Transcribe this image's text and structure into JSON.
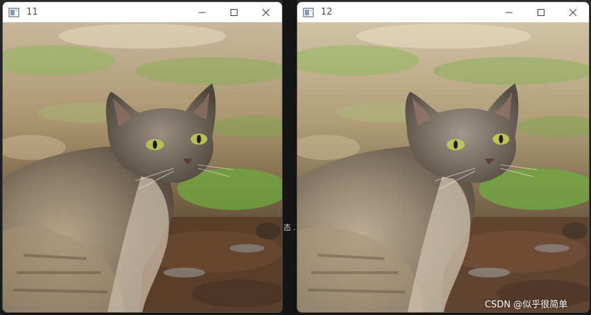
{
  "windows": [
    {
      "title": "11",
      "controls": [
        "minimize",
        "maximize",
        "close"
      ],
      "image": "cat-photo"
    },
    {
      "title": "12",
      "controls": [
        "minimize",
        "maximize",
        "close"
      ],
      "image": "cat-photo-brightened"
    }
  ],
  "desktop": {
    "gap_mark": "态 ."
  },
  "watermark": "CSDN @似乎很简单",
  "colors": {
    "titlebar": "#ffffff",
    "title_text": "#4c4c4c",
    "control_glyph": "#3a3a3a",
    "desktop": "#1f1f1f",
    "cat_fur": "#7b7062",
    "cat_eye": "#b4be57",
    "grass": "#6fa53f",
    "soil": "#5b3e2a"
  },
  "icons": {
    "app": "window-app-icon",
    "minimize": "minimize-icon",
    "maximize": "maximize-icon",
    "close": "close-icon"
  }
}
